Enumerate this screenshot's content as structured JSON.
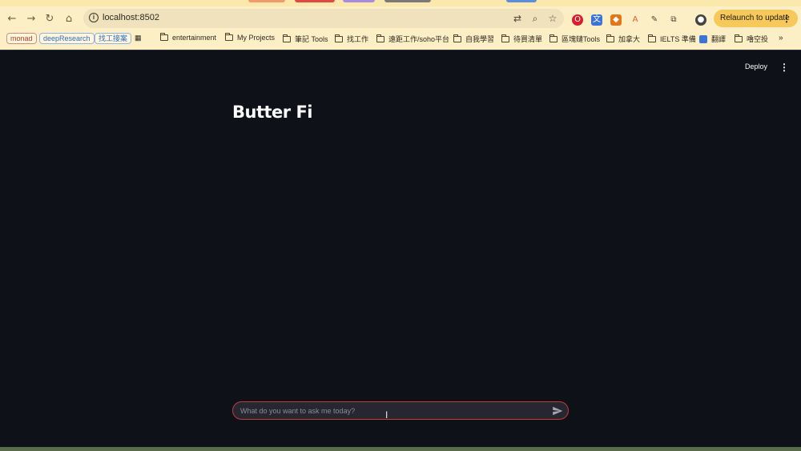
{
  "browser": {
    "url": "localhost:8502",
    "relaunch_label": "Relaunch to update",
    "bookmarks": {
      "chips": [
        "monad",
        "deepResearch",
        "找工接案"
      ],
      "folders": [
        "entertainment",
        "My Projects",
        "筆記 Tools",
        "找工作",
        "遠距工作/soho平台",
        "自我學習",
        "待買清單",
        "區塊鏈Tools",
        "加拿大",
        "IELTS 準備",
        "翻譯",
        "嚕空投"
      ],
      "overflow": "»"
    }
  },
  "app": {
    "deploy_label": "Deploy",
    "title": "Butter Fi",
    "chat_placeholder": "What do you want to ask me today?"
  },
  "colors": {
    "app_background": "#0e1117",
    "accent_border": "#c63a3a",
    "relaunch": "#f7c95a"
  }
}
